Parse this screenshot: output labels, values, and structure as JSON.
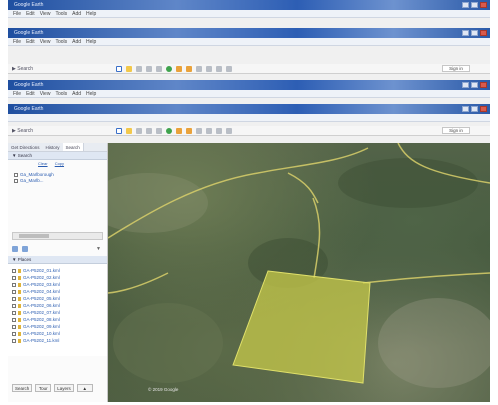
{
  "windows": [
    {
      "title": "Google Earth",
      "menu": [
        "File",
        "Edit",
        "View",
        "Tools",
        "Add",
        "Help"
      ],
      "toolbar_label": "▶ Search",
      "signin": "Sign in"
    },
    {
      "title": "Google Earth",
      "menu": [
        "File",
        "Edit",
        "View",
        "Tools",
        "Add",
        "Help"
      ],
      "toolbar_label": "▶ Search",
      "signin": "Sign in"
    }
  ],
  "sidebar": {
    "tabs": [
      "Get Directions",
      "History",
      "Search"
    ],
    "search_section": "▼ Search",
    "links": [
      "Clear",
      "Copy"
    ],
    "results": [
      "Ga_Marlborough",
      "Ga_Marlb..."
    ],
    "places_section": "▼ Places",
    "places": [
      "GA-P5202_01.kml",
      "GA-P5202_02.kml",
      "GA-P5202_03.kml",
      "GA-P5202_04.kml",
      "GA-P5202_05.kml",
      "GA-P5202_06.kml",
      "GA-P5202_07.kml",
      "GA-P5202_08.kml",
      "GA-P5202_09.kml",
      "GA-P5202_10.kml",
      "GA-P5202_11.kml"
    ],
    "bottom_buttons": [
      "Search",
      "Tour",
      "Layers",
      "▲"
    ]
  },
  "map": {
    "scale_label": "© 2019 Google",
    "polygon_color": "#c7c94a",
    "road_color": "#d8cf6a"
  },
  "colors": {
    "titlebar": "#2d5eb4",
    "accent": "#2a5cb0"
  }
}
